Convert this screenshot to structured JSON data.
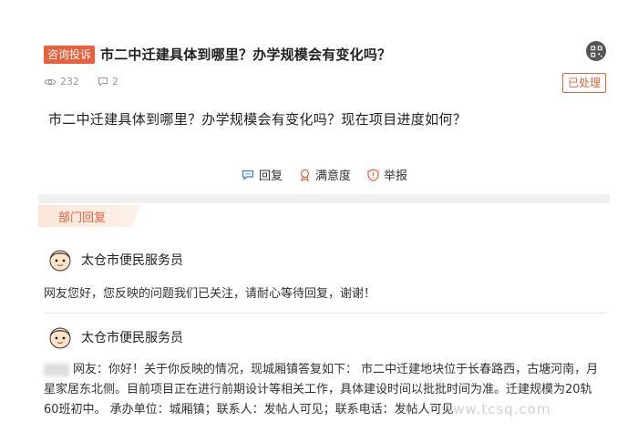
{
  "post": {
    "tag": "咨询投诉",
    "title": "市二中迁建具体到哪里？办学规模会有变化吗？",
    "views": "232",
    "comments": "2",
    "status": "已处理",
    "question": "市二中迁建具体到哪里？办学规模会有变化吗？现在项目进度如何？"
  },
  "actions": {
    "reply": "回复",
    "satisfaction": "满意度",
    "report": "举报"
  },
  "section": {
    "dept_reply_tab": "部门回复"
  },
  "replies": [
    {
      "name": "太仓市便民服务员",
      "body": "网友您好，您反映的问题我们已关注，请耐心等待回复，谢谢！"
    },
    {
      "name": "太仓市便民服务员",
      "body_prefix": "网友：",
      "body": "你好！关于你反映的情况，现城厢镇答复如下： 市二中迁建地块位于长春路西，古塘河南，月星家居东北侧。目前项目正在进行前期设计等相关工作，具体建设时间以批批时间为准。迁建规模为20轨60班初中。 承办单位：城厢镇；联系人：发帖人可见；联系电话：发帖人可见"
    }
  ],
  "watermark": "www.tcsq.com",
  "colors": {
    "accent": "#e8603c"
  }
}
